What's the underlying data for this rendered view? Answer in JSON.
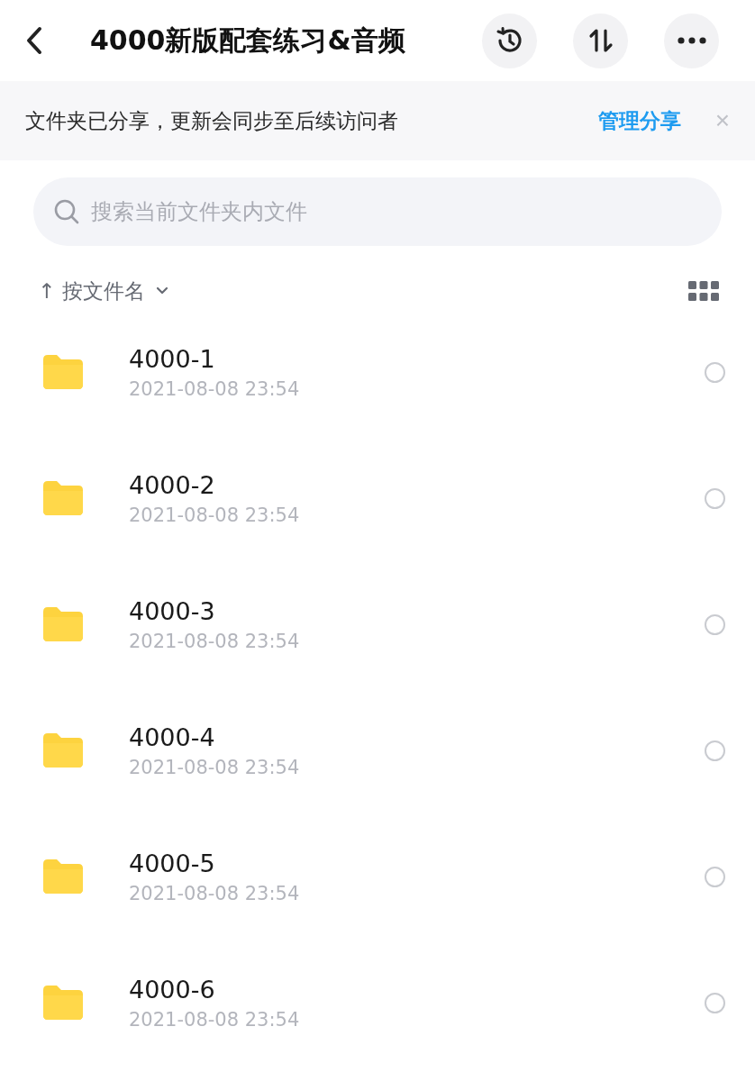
{
  "header": {
    "title": "4000新版配套练习&音频"
  },
  "banner": {
    "text": "文件夹已分享，更新会同步至后续访问者",
    "action": "管理分享",
    "close": "×"
  },
  "search": {
    "placeholder": "搜索当前文件夹内文件"
  },
  "sort": {
    "arrow": "↑",
    "label": "按文件名"
  },
  "files": [
    {
      "name": "4000-1",
      "date": "2021-08-08 23:54",
      "selected": false
    },
    {
      "name": "4000-2",
      "date": "2021-08-08 23:54",
      "selected": false
    },
    {
      "name": "4000-3",
      "date": "2021-08-08 23:54",
      "selected": false
    },
    {
      "name": "4000-4",
      "date": "2021-08-08 23:54",
      "selected": false
    },
    {
      "name": "4000-5",
      "date": "2021-08-08 23:54",
      "selected": false
    },
    {
      "name": "4000-6",
      "date": "2021-08-08 23:54",
      "selected": false
    }
  ]
}
